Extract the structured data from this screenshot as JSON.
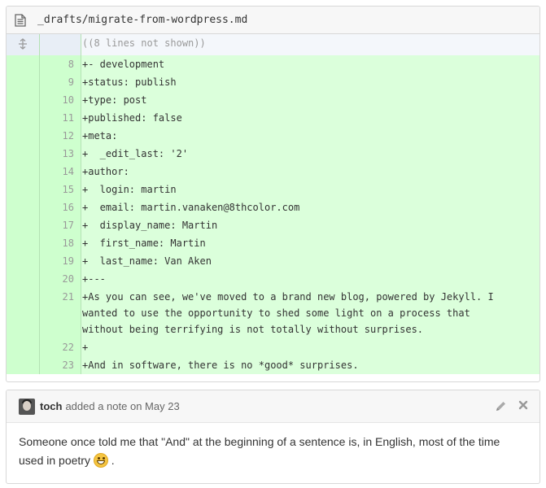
{
  "file": {
    "path": "_drafts/migrate-from-wordpress.md",
    "icon": "file-text-icon"
  },
  "diff": {
    "hunk_text": "((8 lines not shown))",
    "expand_icon": "expand-lines-icon",
    "lines": [
      {
        "num": "8",
        "code": "+- development"
      },
      {
        "num": "9",
        "code": "+status: publish"
      },
      {
        "num": "10",
        "code": "+type: post"
      },
      {
        "num": "11",
        "code": "+published: false"
      },
      {
        "num": "12",
        "code": "+meta:"
      },
      {
        "num": "13",
        "code": "+  _edit_last: '2'"
      },
      {
        "num": "14",
        "code": "+author:"
      },
      {
        "num": "15",
        "code": "+  login: martin"
      },
      {
        "num": "16",
        "code": "+  email: martin.vanaken@8thcolor.com"
      },
      {
        "num": "17",
        "code": "+  display_name: Martin"
      },
      {
        "num": "18",
        "code": "+  first_name: Martin"
      },
      {
        "num": "19",
        "code": "+  last_name: Van Aken"
      },
      {
        "num": "20",
        "code": "+---"
      },
      {
        "num": "21",
        "code": "+As you can see, we've moved to a brand new blog, powered by Jekyll. I wanted to use the opportunity to shed some light on a process that without being terrifying is not totally without surprises."
      },
      {
        "num": "22",
        "code": "+"
      },
      {
        "num": "23",
        "code": "+And in software, there is no *good* surprises."
      }
    ],
    "colors": {
      "add_bg": "#dbffdb",
      "add_num_bg": "#ceffce",
      "hunk_bg": "#f4f7fb"
    }
  },
  "note": {
    "author": "toch",
    "action": "added a note on May 23",
    "body_text": "Someone once told me that \"And\" at the beginning of a sentence is, in English, most of the time used in poetry",
    "body_suffix": " .",
    "emoji": "smile-emoji",
    "edit_icon": "pencil-icon",
    "delete_icon": "close-icon"
  }
}
